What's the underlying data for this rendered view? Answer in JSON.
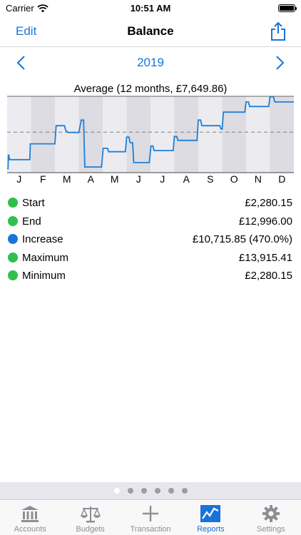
{
  "status_bar": {
    "carrier": "Carrier",
    "time": "10:51 AM",
    "battery_level": 1.0
  },
  "nav": {
    "edit_label": "Edit",
    "title": "Balance",
    "share_icon": "share-icon"
  },
  "year_selector": {
    "year": "2019",
    "prev_icon": "chevron-left-icon",
    "next_icon": "chevron-right-icon"
  },
  "colors": {
    "accent": "#1a73d9",
    "green": "#2fbf4a",
    "blue": "#1a73d9",
    "chart_line": "#1f7fd9"
  },
  "chart_data": {
    "type": "line",
    "title": "Average (12 months, £7,649.86)",
    "categories": [
      "J",
      "F",
      "M",
      "A",
      "M",
      "J",
      "J",
      "A",
      "S",
      "O",
      "N",
      "D"
    ],
    "ylim": [
      500,
      14000
    ],
    "average": 7649.86,
    "series": [
      {
        "values": [
          [
            0,
            1200
          ],
          [
            0.04,
            1200
          ],
          [
            0.05,
            3600
          ],
          [
            0.07,
            3600
          ],
          [
            0.1,
            2800
          ],
          [
            0.95,
            2800
          ],
          [
            0.97,
            5600
          ],
          [
            1.8,
            5600
          ],
          [
            2.0,
            5600
          ],
          [
            2.05,
            8800
          ],
          [
            2.4,
            8800
          ],
          [
            2.45,
            8000
          ],
          [
            2.55,
            7600
          ],
          [
            3.0,
            7600
          ],
          [
            3.1,
            9800
          ],
          [
            3.2,
            9800
          ],
          [
            3.25,
            1500
          ],
          [
            3.95,
            1500
          ],
          [
            4.02,
            4800
          ],
          [
            4.2,
            4800
          ],
          [
            4.25,
            4200
          ],
          [
            4.95,
            4200
          ],
          [
            5.0,
            6800
          ],
          [
            5.1,
            6800
          ],
          [
            5.15,
            5800
          ],
          [
            5.25,
            5800
          ],
          [
            5.3,
            2280
          ],
          [
            5.95,
            2280
          ],
          [
            6.02,
            5200
          ],
          [
            6.1,
            5200
          ],
          [
            6.15,
            4400
          ],
          [
            6.95,
            4400
          ],
          [
            7.0,
            6900
          ],
          [
            7.1,
            6900
          ],
          [
            7.15,
            6200
          ],
          [
            7.95,
            6200
          ],
          [
            8.0,
            9800
          ],
          [
            8.1,
            9800
          ],
          [
            8.15,
            8800
          ],
          [
            8.9,
            8800
          ],
          [
            8.95,
            8200
          ],
          [
            9.0,
            8200
          ],
          [
            9.05,
            11200
          ],
          [
            9.95,
            11200
          ],
          [
            10.0,
            13000
          ],
          [
            10.1,
            13000
          ],
          [
            10.15,
            12200
          ],
          [
            10.95,
            12200
          ],
          [
            11.0,
            13915.41
          ],
          [
            11.15,
            13915.41
          ],
          [
            11.2,
            13000
          ],
          [
            12.0,
            13000
          ]
        ]
      }
    ],
    "grid": true
  },
  "stats": [
    {
      "label": "Start",
      "value": "£2,280.15",
      "color": "#2fbf4a"
    },
    {
      "label": "End",
      "value": "£12,996.00",
      "color": "#2fbf4a"
    },
    {
      "label": "Increase",
      "value": "£10,715.85 (470.0%)",
      "color": "#1a73d9"
    },
    {
      "label": "Maximum",
      "value": "£13,915.41",
      "color": "#2fbf4a"
    },
    {
      "label": "Minimum",
      "value": "£2,280.15",
      "color": "#2fbf4a"
    }
  ],
  "pager": {
    "count": 6,
    "active_index": 0
  },
  "tabs": [
    {
      "label": "Accounts",
      "icon": "bank-icon",
      "active": false
    },
    {
      "label": "Budgets",
      "icon": "scales-icon",
      "active": false
    },
    {
      "label": "Transaction",
      "icon": "plus-icon",
      "active": false
    },
    {
      "label": "Reports",
      "icon": "chart-icon",
      "active": true
    },
    {
      "label": "Settings",
      "icon": "gear-icon",
      "active": false
    }
  ]
}
